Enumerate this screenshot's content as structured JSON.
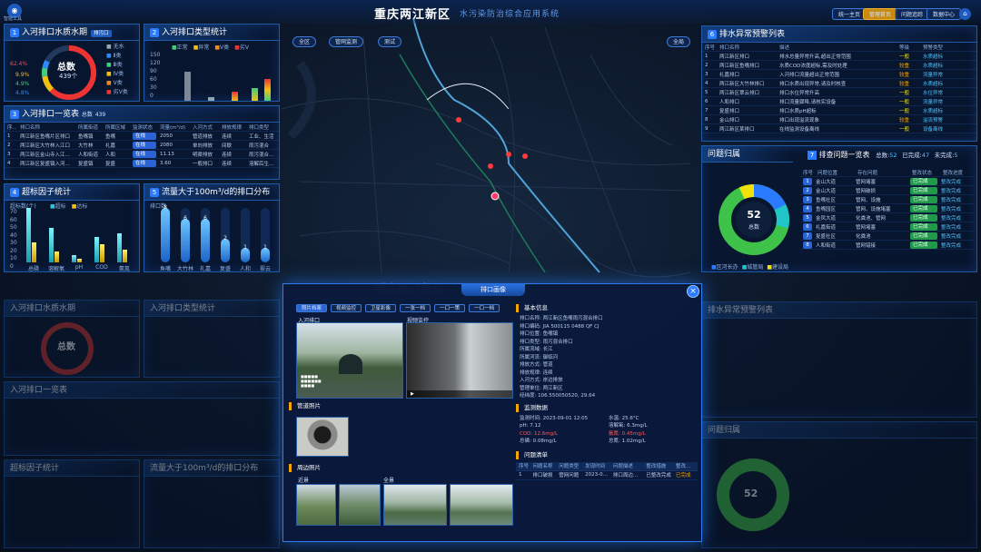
{
  "header": {
    "logo_label": "智能工具",
    "title": "重庆两江新区",
    "subtitle": "水污染防治综合应用系统",
    "buttons": [
      "统一主页",
      "管理首页",
      "问题追踪",
      "数据中心"
    ]
  },
  "map": {
    "tags": [
      "全区",
      "管网监测",
      "测试"
    ],
    "tag_right": "全局"
  },
  "p1": {
    "title": "入河排口水质水期",
    "tab": "排污口",
    "total_label": "总数",
    "total_value": "439个",
    "pcts": [
      "62.4%",
      "9.9%",
      "4.9%",
      "4.8%"
    ],
    "legend": [
      "无水",
      "Ⅱ类",
      "Ⅲ类",
      "Ⅳ类",
      "Ⅴ类",
      "劣Ⅴ类"
    ]
  },
  "p2": {
    "title": "入河排口类型统计",
    "legend": [
      "正常",
      "异常",
      "Ⅴ类",
      "劣Ⅴ"
    ],
    "yticks": [
      "150",
      "120",
      "90",
      "60",
      "30",
      "0"
    ],
    "cats": [
      "工业排口",
      "城镇污水",
      "雨污混合",
      "农业排口",
      "其他"
    ]
  },
  "p3": {
    "title": "入河排口一览表",
    "count_label": "总数",
    "count": "439",
    "cols": [
      "序号",
      "排口名称",
      "所属街道",
      "所属区域",
      "监测状态",
      "流量(m³/d)",
      "入河方式",
      "排放规律",
      "排口类型"
    ],
    "rows": [
      [
        "1",
        "两江新区鱼嘴片区排口",
        "鱼嘴镇",
        "鱼嘴",
        "在线",
        "2050",
        "管道排放",
        "连续",
        "工业、生活"
      ],
      [
        "2",
        "两江新区大竹林入江口",
        "大竹林",
        "礼嘉",
        "在线",
        "2080",
        "单向排放",
        "间歇",
        "雨污混合"
      ],
      [
        "3",
        "两江新区金山寺入江口排口",
        "人和街道",
        "人和",
        "在线",
        "11.13",
        "明渠排放",
        "连续",
        "雨污混合排口"
      ],
      [
        "4",
        "两江新区复盛镇入河排口",
        "复盛镇",
        "复盛",
        "在线",
        "3.60",
        "一般排口",
        "连续",
        "溶解后生活排口"
      ]
    ]
  },
  "p4": {
    "title": "超标因子统计",
    "unit": "超标数(个)",
    "legend": [
      "超标",
      "达标"
    ],
    "yticks": [
      "70",
      "60",
      "50",
      "40",
      "30",
      "20",
      "10",
      "0"
    ],
    "cats": [
      "总磷",
      "溶解氧",
      "pH",
      "COD",
      "氨氮"
    ]
  },
  "p5": {
    "title": "流量大于100m³/d的排口分布",
    "unit": "排口数",
    "cats": [
      "鱼嘴",
      "大竹林",
      "礼嘉",
      "复盛",
      "人和",
      "翠云"
    ],
    "labels": [
      "8",
      "6",
      "6",
      "2",
      "1",
      "1"
    ]
  },
  "right_list": {
    "title": "排水异常预警列表",
    "cols": [
      "序号",
      "排口名称",
      "描述",
      "等级",
      "预警类型"
    ],
    "rows": [
      [
        "1",
        "两江新区排口",
        "排水总量异常升高,超出正常范围",
        "一般",
        "水质超标"
      ],
      [
        "2",
        "两江新区鱼嘴排口",
        "水质COD浓度超标,需及时处理",
        "较重",
        "水质超标"
      ],
      [
        "3",
        "礼嘉排口",
        "入河排口流量超出正常范围",
        "较重",
        "流量异常"
      ],
      [
        "4",
        "两江新区大竹林排口",
        "排口水质出现异常,请及时核查",
        "较重",
        "水质超标"
      ],
      [
        "5",
        "两江新区翠云排口",
        "排口水位异常升高",
        "一般",
        "水位异常"
      ],
      [
        "6",
        "人和排口",
        "排口流量骤降,请核实设备",
        "一般",
        "流量异常"
      ],
      [
        "7",
        "复盛排口",
        "排口水质pH超标",
        "一般",
        "水质超标"
      ],
      [
        "8",
        "金山排口",
        "排口出现溢流现象",
        "较重",
        "溢流预警"
      ],
      [
        "9",
        "两江新区某排口",
        "在线监测设备离线",
        "一般",
        "设备离线"
      ]
    ]
  },
  "issues": {
    "title": "问题归属",
    "donut_value": "52",
    "donut_label": "总数",
    "legend": [
      "区河长办",
      "城管局",
      "建设局"
    ],
    "table_title": "排查问题一览表",
    "total_label": "总数:",
    "total": "52",
    "done_label": "已完成:",
    "done": "47",
    "todo_label": "未完成:",
    "todo": "5",
    "cols": [
      "序号",
      "问题位置",
      "存在问题",
      "整改状态",
      "整改进度"
    ],
    "rows": [
      [
        "1",
        "金山大道",
        "管网堵塞",
        "已完成",
        "整改完成"
      ],
      [
        "2",
        "金山大道",
        "管网破损",
        "已完成",
        "整改完成"
      ],
      [
        "3",
        "鱼嘴社区",
        "管网、设施",
        "已完成",
        "整改完成"
      ],
      [
        "4",
        "鱼嘴园区",
        "管网、设施堵塞",
        "已完成",
        "整改完成"
      ],
      [
        "5",
        "金凤大道",
        "化粪池、管网",
        "已完成",
        "整改完成"
      ],
      [
        "6",
        "礼嘉街道",
        "管网堵塞",
        "已完成",
        "整改完成"
      ],
      [
        "7",
        "复盛社区",
        "化粪池",
        "已完成",
        "整改完成"
      ],
      [
        "8",
        "人和街道",
        "管网错接",
        "已完成",
        "整改完成"
      ]
    ]
  },
  "modal": {
    "title": "排口画像",
    "tabs": [
      "照片档案",
      "视频监控",
      "卫星影像",
      "一张一档",
      "一口一策",
      "一口一档"
    ],
    "photo_caption": "入河排口",
    "video_caption": "视频监控",
    "sec_info": "基本信息",
    "sec_quality": "监测数据",
    "sec_pipe": "管道照片",
    "sec_surround": "周边照片",
    "sec_issue": "问题清单",
    "info": [
      "排口名称: 两江新区鱼嘴雨污混合排口",
      "排口编码: JIA 500115 0488 QF CJ",
      "排口位置: 鱼嘴镇",
      "排口类型: 雨污混合排口",
      "所属流域: 长江",
      "所属河流: 御临河",
      "排放方式: 管道",
      "排放规律: 连续",
      "入河方式: 岸边排放",
      "管理单位: 两江新区",
      "经纬度: 106.550050520, 29.64"
    ],
    "quality": [
      "监测时间: 2023-09-01 12:05",
      "水温: 25.6°C",
      "pH: 7.12",
      "溶解氧: 6.3mg/L",
      "COD: 12.6mg/L",
      "氨氮: 0.45mg/L",
      "总磷: 0.08mg/L",
      "总氮: 1.02mg/L"
    ],
    "issue_cols": [
      "序号",
      "问题名称",
      "问题类型",
      "发现时间",
      "问题描述",
      "整改措施",
      "整改状态"
    ],
    "issue_row": [
      "1",
      "排口破损",
      "管网问题",
      "2023-08-26",
      "排口周边有破损",
      "已整改完成",
      "已完成"
    ],
    "surround_captions": [
      "近景",
      "全景"
    ]
  }
}
